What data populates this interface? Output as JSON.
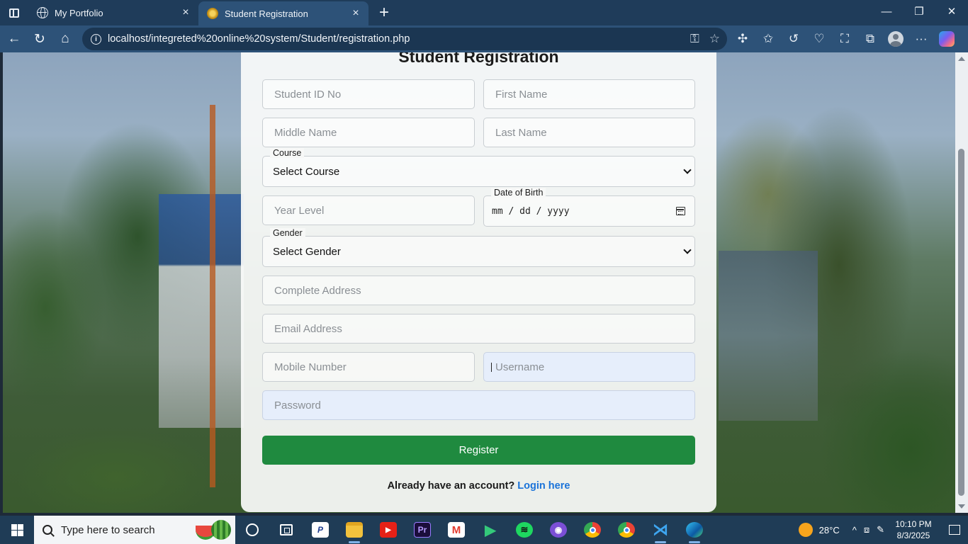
{
  "browser": {
    "tabs": [
      {
        "title": "My Portfolio",
        "active": false,
        "icon": "globe-icon"
      },
      {
        "title": "Student Registration",
        "active": true,
        "icon": "school-seal-icon"
      }
    ],
    "url": "localhost/integreted%20online%20system/Student/registration.php"
  },
  "form": {
    "title": "Student Registration",
    "student_id_placeholder": "Student ID No",
    "first_name_placeholder": "First Name",
    "middle_name_placeholder": "Middle Name",
    "last_name_placeholder": "Last Name",
    "course_label": "Course",
    "course_value": "Select Course",
    "year_level_placeholder": "Year Level",
    "dob_label": "Date of Birth",
    "dob_value": "mm / dd / yyyy",
    "gender_label": "Gender",
    "gender_value": "Select Gender",
    "address_placeholder": "Complete Address",
    "email_placeholder": "Email Address",
    "mobile_placeholder": "Mobile Number",
    "username_placeholder": "Username",
    "password_placeholder": "Password",
    "register_label": "Register",
    "login_prompt": "Already have an account?",
    "login_link": "Login here"
  },
  "colors": {
    "register_button": "#1f8a3f",
    "login_link": "#1a73d9",
    "autofill_field": "#e6eefb"
  },
  "taskbar": {
    "search_placeholder": "Type here to search",
    "pinned_apps": [
      "cortana-icon",
      "task-view-icon",
      "paypal-icon",
      "file-explorer-icon",
      "youtube-icon",
      "premiere-pro-icon",
      "gmail-icon",
      "google-play-icon",
      "spotify-icon",
      "github-desktop-icon",
      "chrome-icon",
      "chrome-profile-icon",
      "vscode-icon",
      "edge-icon"
    ],
    "weather": "28°C",
    "time": "10:10 PM",
    "date": "8/3/2025"
  }
}
